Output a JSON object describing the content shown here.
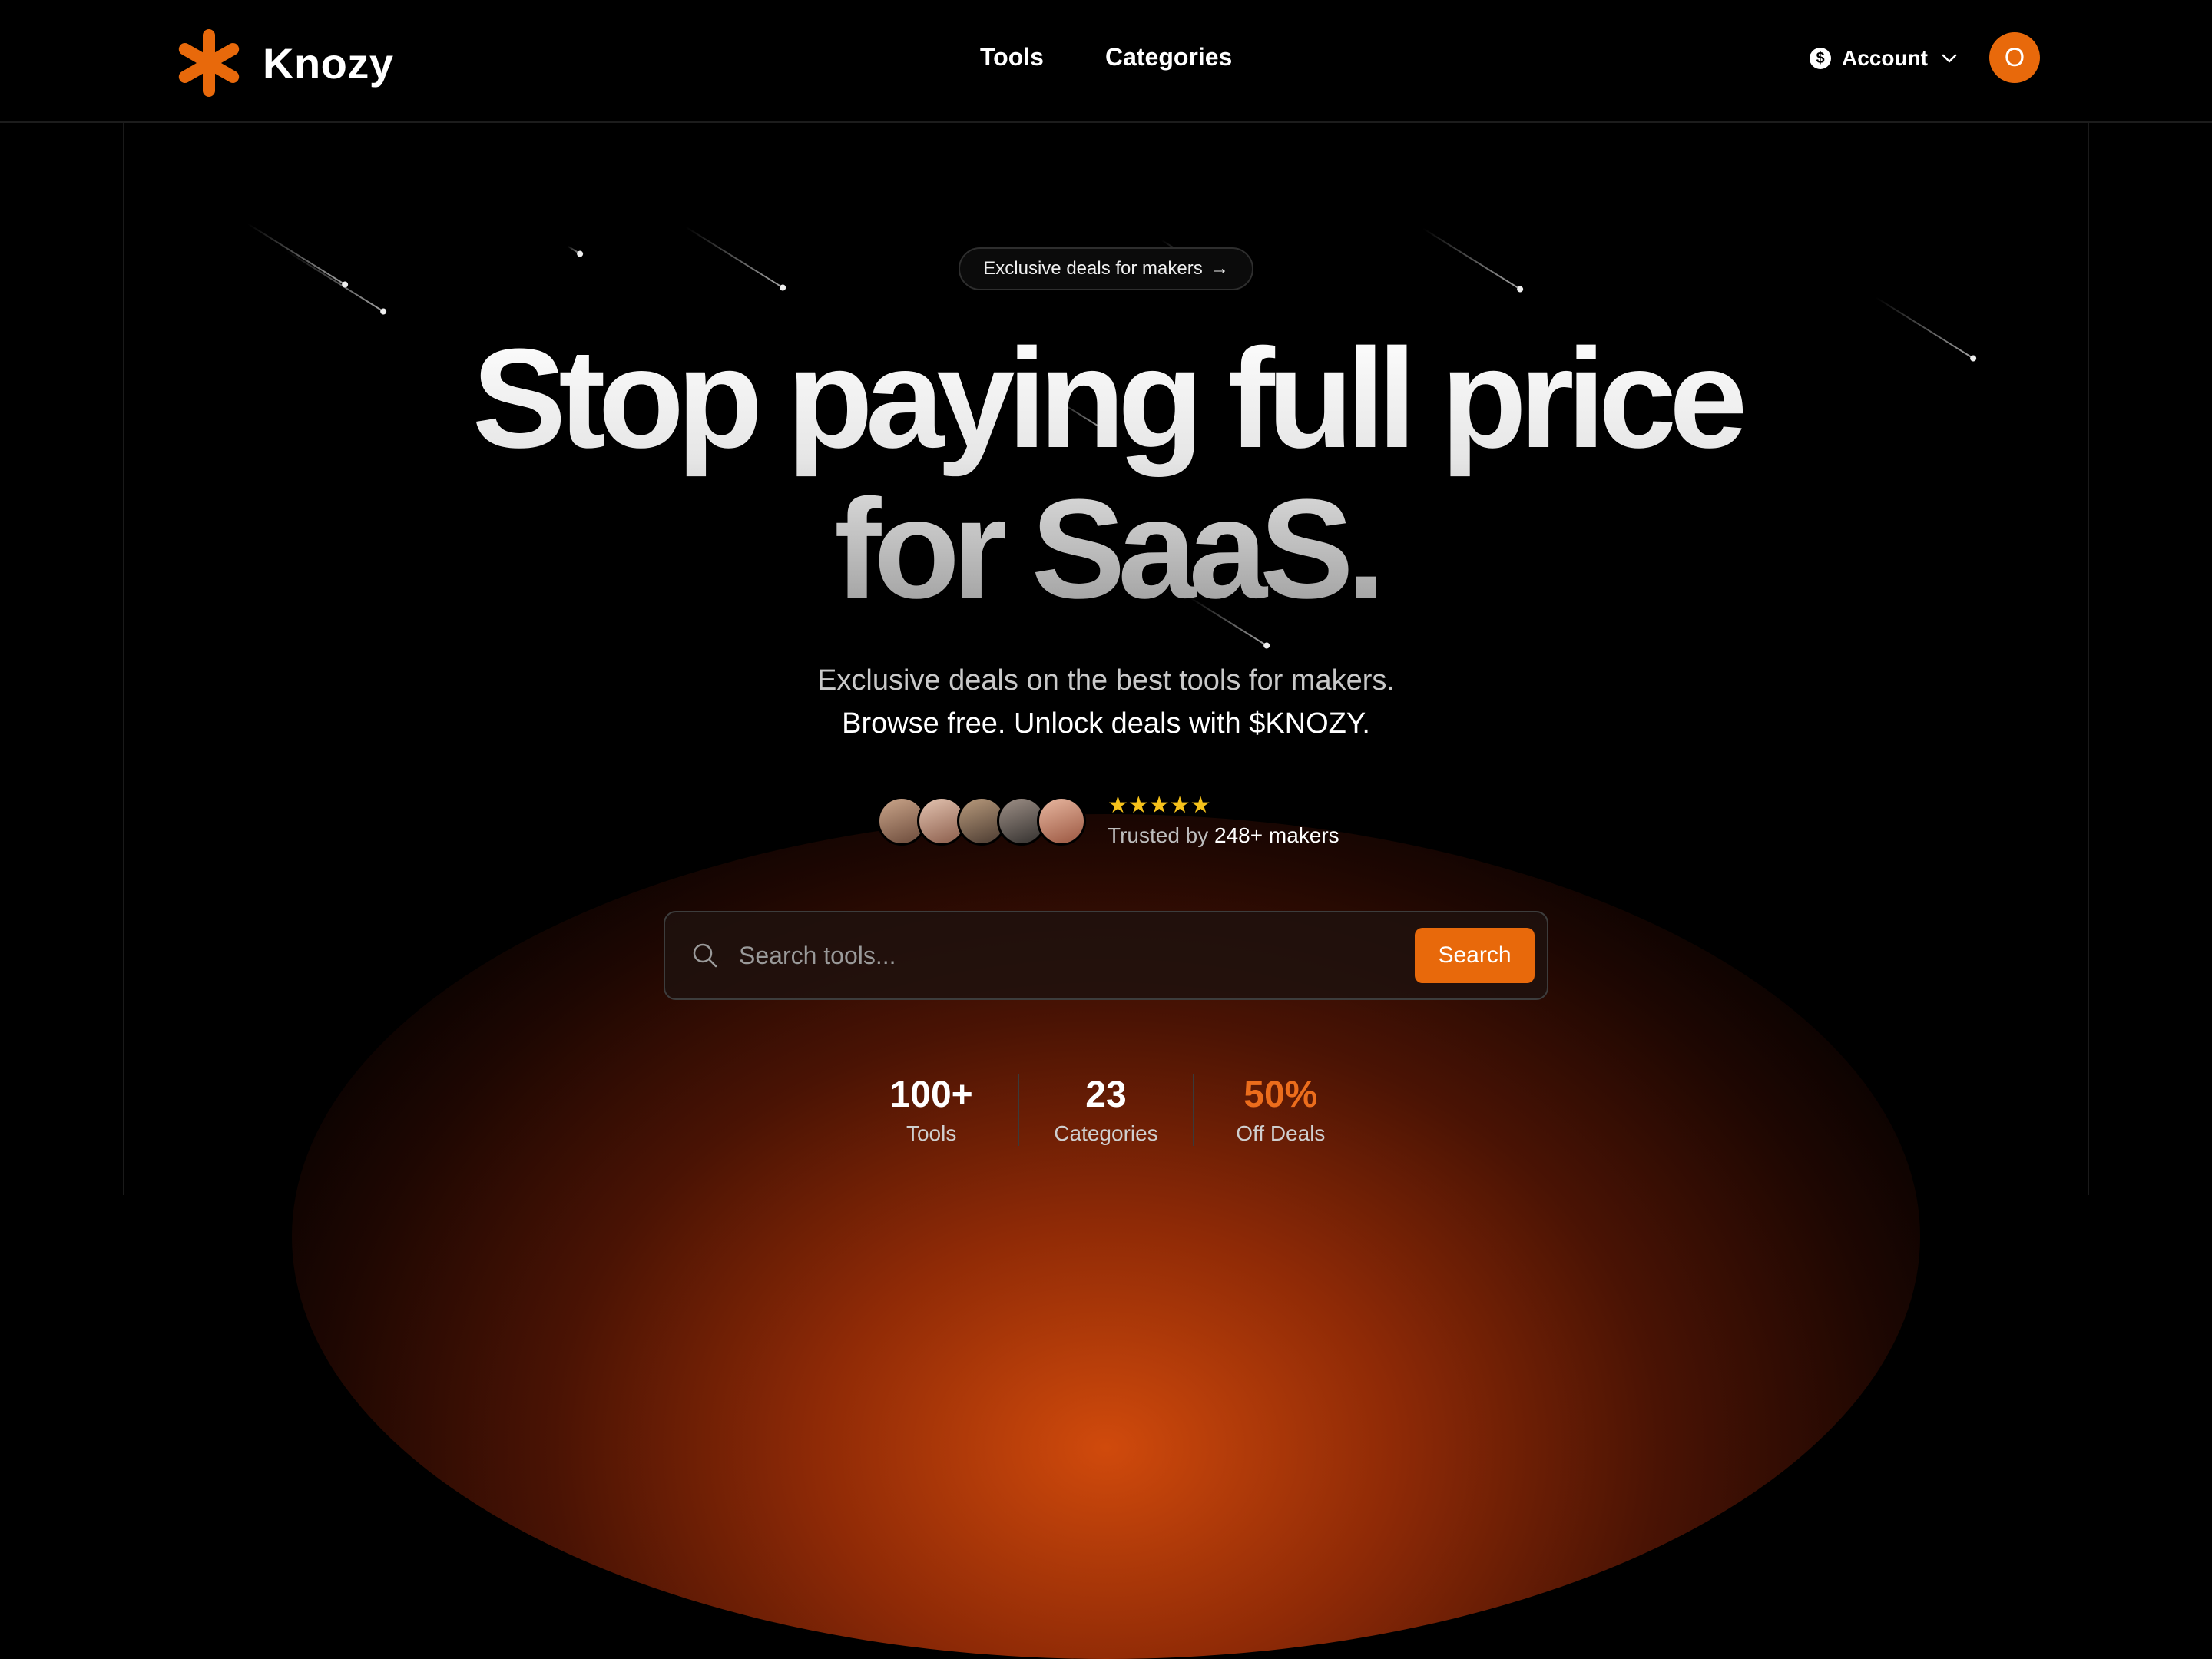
{
  "brand": {
    "name": "Knozy",
    "accent": "#e8690b"
  },
  "nav": {
    "items": [
      "Tools",
      "Categories"
    ]
  },
  "account": {
    "label": "Account",
    "currency_symbol": "$",
    "avatar_initial": "O"
  },
  "hero": {
    "pill_label": "Exclusive deals for makers",
    "pill_arrow": "→",
    "headline_line1": "Stop paying full price",
    "headline_line2": "for SaaS.",
    "subtitle_line1": "Exclusive deals on the best tools for makers.",
    "subtitle_line2": "Browse free. Unlock deals with $KNOZY."
  },
  "social_proof": {
    "stars": "★★★★★",
    "trusted_prefix": "Trusted by",
    "trusted_count": "248+ makers"
  },
  "search": {
    "placeholder": "Search tools...",
    "button_label": "Search"
  },
  "stats": [
    {
      "value": "100+",
      "label": "Tools"
    },
    {
      "value": "23",
      "label": "Categories"
    },
    {
      "value": "50%",
      "label": "Off Deals"
    }
  ]
}
